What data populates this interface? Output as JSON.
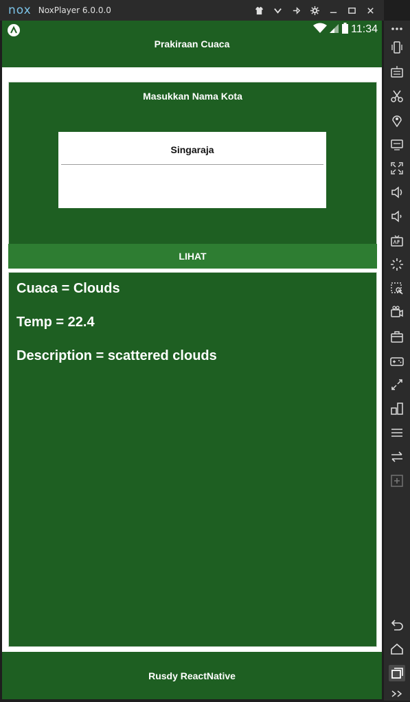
{
  "emulator": {
    "logo": "nox",
    "version": "NoxPlayer 6.0.0.0",
    "titlebar_icons": [
      "shirt-icon",
      "chevron-down-icon",
      "pin-icon",
      "gear-icon",
      "minimize-icon",
      "maximize-icon",
      "close-icon"
    ],
    "sidebar_icons": [
      "more-icon",
      "shake-icon",
      "keyboard-icon",
      "scissors-icon",
      "location-icon",
      "screen-icon",
      "fullscreen-icon",
      "volume-up-icon",
      "volume-down-icon",
      "apk-icon",
      "loading-icon",
      "screenshot-icon",
      "video-icon",
      "toolbox-icon",
      "gamepad-icon",
      "sync-icon",
      "multi-instance-icon",
      "menu-icon",
      "swap-icon",
      "add-icon",
      "back-icon",
      "home-icon",
      "recent-apps-icon",
      "expand-icon"
    ]
  },
  "statusbar": {
    "time": "11:34"
  },
  "app": {
    "title": "Prakiraan Cuaca",
    "input_label": "Masukkan Nama Kota",
    "city_value": "Singaraja",
    "button_label": "LIHAT",
    "result": {
      "cuaca": "Cuaca = Clouds",
      "temp": "Temp = 22.4",
      "description": "Description = scattered clouds"
    },
    "footer": "Rusdy ReactNative"
  },
  "colors": {
    "primary_green": "#1e5f22",
    "button_green": "#2e7d32",
    "emulator_frame": "#2b2b2b"
  }
}
